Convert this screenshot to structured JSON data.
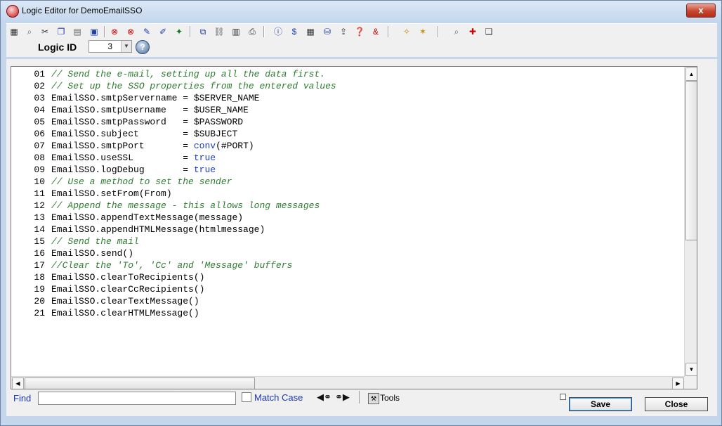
{
  "window": {
    "title": "Logic Editor for DemoEmailSSO",
    "close_glyph": "x"
  },
  "toolbar": {
    "icons": [
      "grid-icon",
      "search-icon",
      "cut-icon",
      "copy-icon",
      "paste-icon",
      "clipboard-icon",
      "delete-left-icon",
      "delete-right-icon",
      "pencil-icon",
      "pencil-x-icon",
      "wand-icon",
      "find-replace-icon",
      "link-icon",
      "notes-icon",
      "print-icon",
      "info-icon",
      "dollar-icon",
      "table-icon",
      "database-icon",
      "export-icon",
      "help-bubble-icon",
      "bookmark-icon",
      "star-icon",
      "page-star-icon",
      "zoom-icon",
      "add-icon",
      "book-icon"
    ]
  },
  "logic": {
    "label": "Logic ID",
    "value": "3",
    "help": "?"
  },
  "editor": {
    "lines": [
      {
        "n": "01",
        "text": "// Send the e-mail, setting up all the data first.",
        "type": "comment"
      },
      {
        "n": "02",
        "text": "// Set up the SSO properties from the entered values",
        "type": "comment"
      },
      {
        "n": "03",
        "text": "EmailSSO.smtpServername = $SERVER_NAME",
        "type": "code"
      },
      {
        "n": "04",
        "text": "EmailSSO.smtpUsername   = $USER_NAME",
        "type": "code"
      },
      {
        "n": "05",
        "text": "EmailSSO.smtpPassword   = $PASSWORD",
        "type": "code"
      },
      {
        "n": "06",
        "text": "EmailSSO.subject        = $SUBJECT",
        "type": "code"
      },
      {
        "n": "07",
        "pre": "EmailSSO.smtpPort       = ",
        "kw": "conv",
        "post": "(#PORT)",
        "type": "kw"
      },
      {
        "n": "08",
        "pre": "EmailSSO.useSSL         = ",
        "kw": "true",
        "post": "",
        "type": "kw"
      },
      {
        "n": "09",
        "pre": "EmailSSO.logDebug       = ",
        "kw": "true",
        "post": "",
        "type": "kw"
      },
      {
        "n": "10",
        "text": "// Use a method to set the sender",
        "type": "comment"
      },
      {
        "n": "11",
        "text": "EmailSSO.setFrom(From)",
        "type": "code"
      },
      {
        "n": "12",
        "text": "// Append the message - this allows long messages",
        "type": "comment"
      },
      {
        "n": "13",
        "text": "EmailSSO.appendTextMessage(message)",
        "type": "code"
      },
      {
        "n": "14",
        "text": "EmailSSO.appendHTMLMessage(htmlmessage)",
        "type": "code"
      },
      {
        "n": "15",
        "text": "// Send the mail",
        "type": "comment"
      },
      {
        "n": "16",
        "text": "EmailSSO.send()",
        "type": "code"
      },
      {
        "n": "17",
        "text": "//Clear the 'To', 'Cc' and 'Message' buffers",
        "type": "comment"
      },
      {
        "n": "18",
        "text": "EmailSSO.clearToRecipients()",
        "type": "code"
      },
      {
        "n": "19",
        "text": "EmailSSO.clearCcRecipients()",
        "type": "code"
      },
      {
        "n": "20",
        "text": "EmailSSO.clearTextMessage()",
        "type": "code"
      },
      {
        "n": "21",
        "text": "EmailSSO.clearHTMLMessage()",
        "type": "code"
      }
    ]
  },
  "find": {
    "label": "Find",
    "value": "",
    "match_case_label": "Match Case",
    "match_case_checked": false
  },
  "tools": {
    "label": "Tools"
  },
  "buttons": {
    "save": "Save",
    "close": "Close"
  },
  "colors": {
    "comment": "#2e7d32",
    "keyword": "#1d3dbf",
    "find_label": "#1b36b5",
    "title_gradient": "#c6d8ee"
  }
}
